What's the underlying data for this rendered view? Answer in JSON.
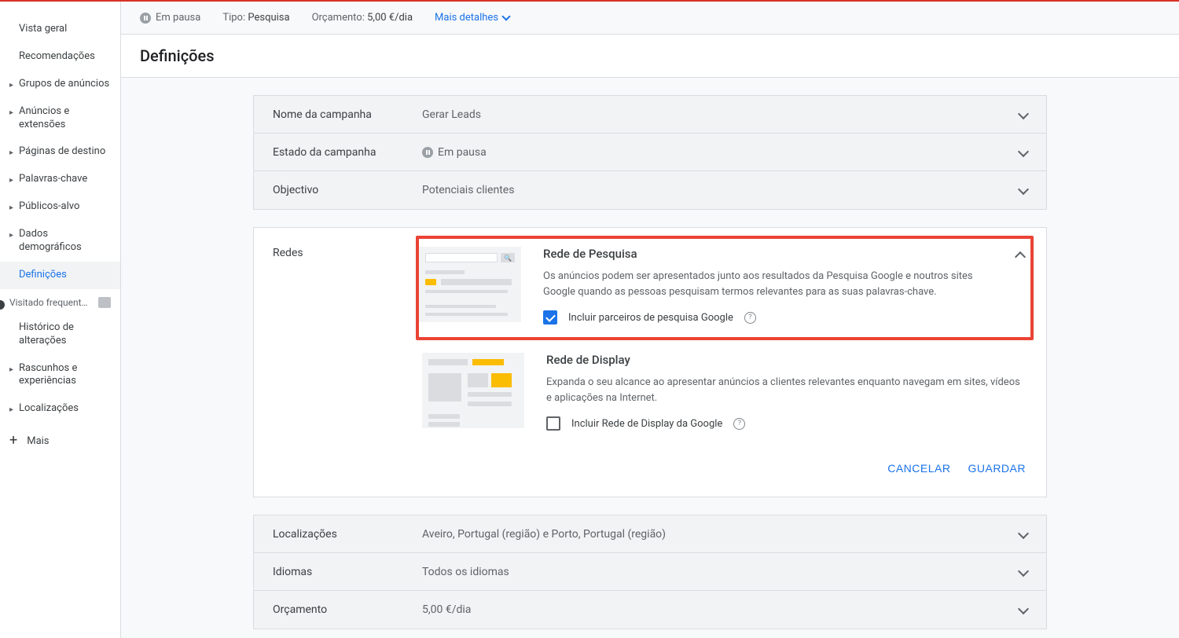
{
  "topbar": {
    "status_label": "Em pausa",
    "type_label": "Tipo:",
    "type_value": "Pesquisa",
    "budget_label": "Orçamento:",
    "budget_value": "5,00 €/dia",
    "details": "Mais detalhes"
  },
  "page_title": "Definições",
  "sidebar": {
    "items": [
      {
        "label": "Vista geral",
        "caret": false
      },
      {
        "label": "Recomendações",
        "caret": false
      },
      {
        "label": "Grupos de anúncios",
        "caret": true
      },
      {
        "label": "Anúncios e extensões",
        "caret": true
      },
      {
        "label": "Páginas de destino",
        "caret": true
      },
      {
        "label": "Palavras-chave",
        "caret": true
      },
      {
        "label": "Públicos-alvo",
        "caret": true
      },
      {
        "label": "Dados demográficos",
        "caret": true
      },
      {
        "label": "Definições",
        "caret": false,
        "selected": true
      }
    ],
    "frequent_label": "Visitado frequent…",
    "frequent_items": [
      {
        "label": "Histórico de alterações",
        "caret": false
      },
      {
        "label": "Rascunhos e experiências",
        "caret": true
      },
      {
        "label": "Localizações",
        "caret": true
      }
    ],
    "more": "Mais"
  },
  "summary_rows": [
    {
      "label": "Nome da campanha",
      "value": "Gerar Leads"
    },
    {
      "label": "Estado da campanha",
      "value": "Em pausa",
      "has_pause_icon": true
    },
    {
      "label": "Objectivo",
      "value": "Potenciais clientes"
    }
  ],
  "networks": {
    "section_label": "Redes",
    "search": {
      "title": "Rede de Pesquisa",
      "desc": "Os anúncios podem ser apresentados junto aos resultados da Pesquisa Google e noutros sites Google quando as pessoas pesquisam termos relevantes para as suas palavras-chave.",
      "checkbox_label": "Incluir parceiros de pesquisa Google",
      "checked": true
    },
    "display": {
      "title": "Rede de Display",
      "desc": "Expanda o seu alcance ao apresentar anúncios a clientes relevantes enquanto navegam em sites, vídeos e aplicações na Internet.",
      "checkbox_label": "Incluir Rede de Display da Google",
      "checked": false
    },
    "cancel": "CANCELAR",
    "save": "GUARDAR"
  },
  "bottom_rows": [
    {
      "label": "Localizações",
      "value": "Aveiro, Portugal (região) e Porto, Portugal (região)"
    },
    {
      "label": "Idiomas",
      "value": "Todos os idiomas"
    },
    {
      "label": "Orçamento",
      "value": "5,00 €/dia"
    }
  ]
}
